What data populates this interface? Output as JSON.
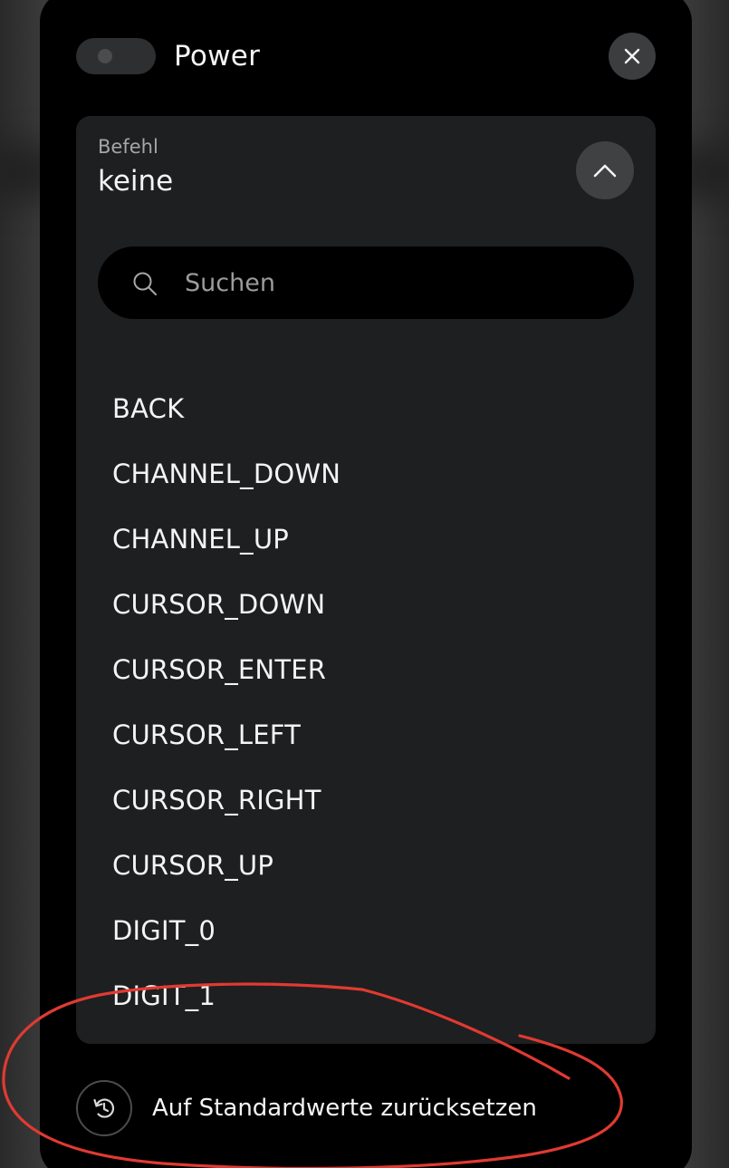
{
  "header": {
    "toggle_state": "off",
    "title": "Power",
    "close_icon": "close-icon"
  },
  "command_field": {
    "label": "Befehl",
    "value": "keine",
    "expand_state": "expanded",
    "toggle_icon": "chevron-up-icon"
  },
  "search": {
    "placeholder": "Suchen",
    "value": "",
    "icon": "search-icon"
  },
  "options": [
    "BACK",
    "CHANNEL_DOWN",
    "CHANNEL_UP",
    "CURSOR_DOWN",
    "CURSOR_ENTER",
    "CURSOR_LEFT",
    "CURSOR_RIGHT",
    "CURSOR_UP",
    "DIGIT_0",
    "DIGIT_1"
  ],
  "footer": {
    "reset_label": "Auf Standardwerte zurücksetzen",
    "reset_icon": "reset-icon"
  },
  "colors": {
    "panel_bg": "#000000",
    "card_bg": "#1e1f20",
    "button_bg": "#3b3d3e",
    "text": "#f4f4f4",
    "muted_text": "#a4a6a7",
    "annotation_stroke": "#e03a32"
  }
}
